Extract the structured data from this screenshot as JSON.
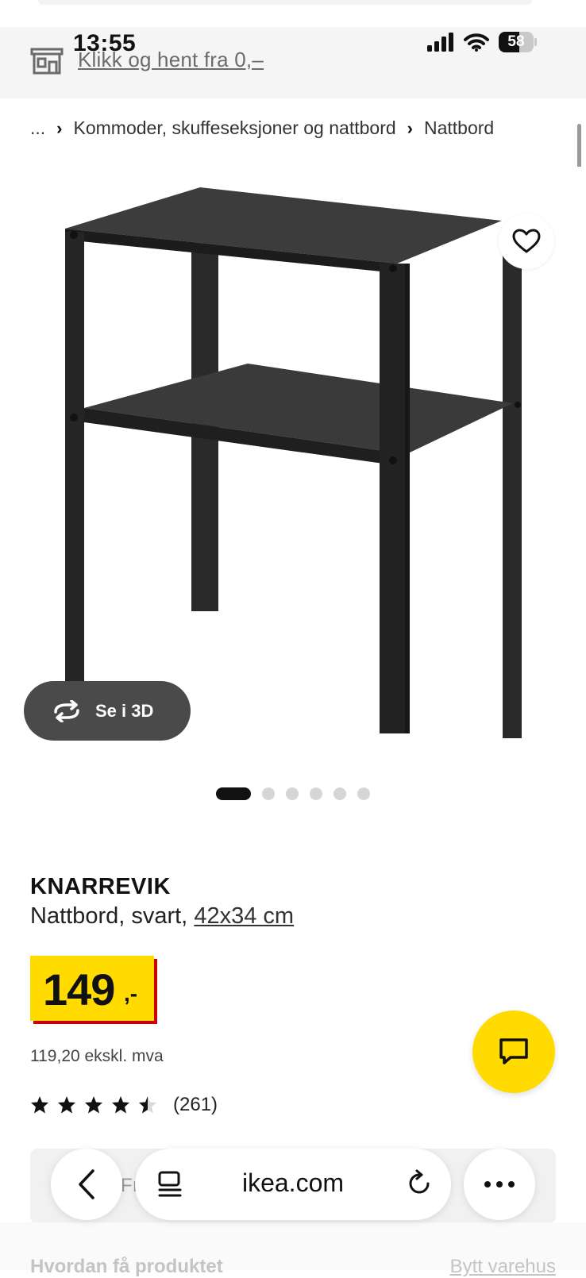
{
  "status_bar": {
    "time": "13:55",
    "battery": "58",
    "battery_level": 0.58
  },
  "promo": {
    "link_text": "Klikk og hent fra 0,–"
  },
  "breadcrumb": {
    "ellipsis": "...",
    "separator": "›",
    "items": [
      "Kommoder, skuffeseksjoner og nattbord",
      "Nattbord"
    ]
  },
  "gallery": {
    "view_3d_label": "Se i 3D",
    "image_count": 6,
    "active_index": 0
  },
  "product": {
    "name": "KNARREVIK",
    "description": "Nattbord, svart, ",
    "size": "42x34 cm",
    "price": "149",
    "price_suffix": ",-",
    "price_excl_vat": "119,20 ekskl. mva",
    "rating": 4.5,
    "review_count": "(261)"
  },
  "colors": {
    "brand_yellow": "#ffdb00",
    "brand_red": "#cc0008",
    "dark_button": "#4a4a4a"
  },
  "obscured": {
    "under_bar_text": "Fı",
    "heading_peek": "Hvordan få produktet",
    "link_peek": "Bytt varehus"
  },
  "browser": {
    "url": "ikea.com"
  },
  "icons": {
    "store": "store-icon",
    "heart": "heart-icon",
    "rotate": "rotate-3d-icon",
    "chat": "chat-icon",
    "back": "chevron-left-icon",
    "reader": "reader-mode-icon",
    "reload": "reload-icon",
    "more": "more-icon"
  }
}
